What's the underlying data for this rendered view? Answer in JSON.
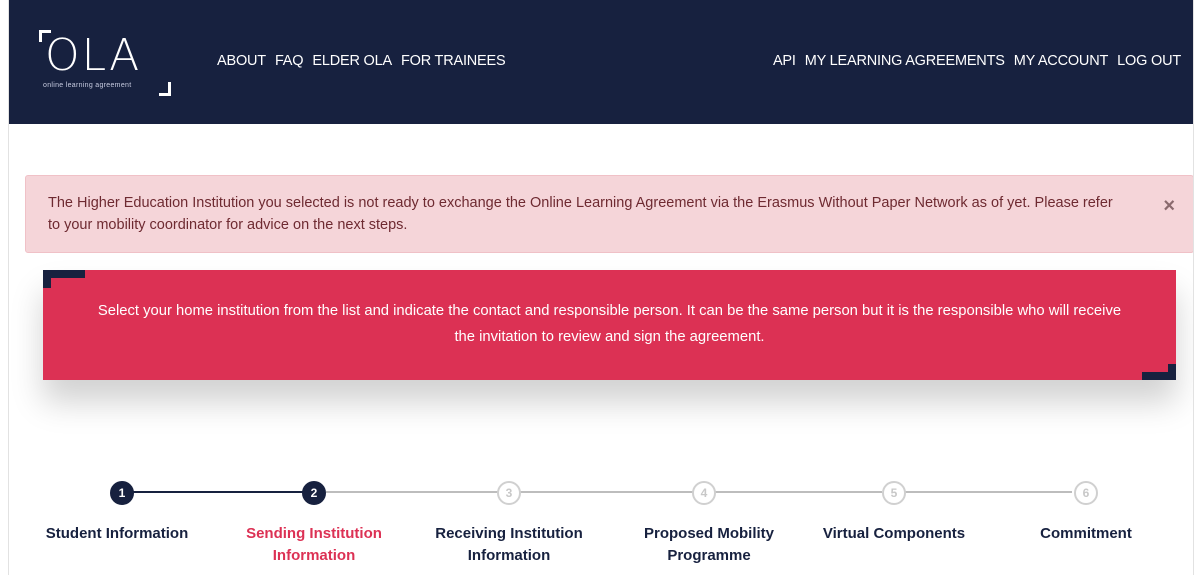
{
  "header": {
    "logo": {
      "text": "OLA",
      "subtitle": "online learning agreement"
    },
    "nav_left": [
      {
        "label": "ABOUT"
      },
      {
        "label": "FAQ"
      },
      {
        "label": "ELDER OLA"
      },
      {
        "label": "FOR TRAINEES"
      }
    ],
    "nav_right": [
      {
        "label": "API"
      },
      {
        "label": "MY LEARNING AGREEMENTS"
      },
      {
        "label": "MY ACCOUNT"
      },
      {
        "label": "LOG OUT"
      }
    ]
  },
  "alert": {
    "message": "The Higher Education Institution you selected is not ready to exchange the Online Learning Agreement via the Erasmus Without Paper Network as of yet. Please refer to your mobility coordinator for advice on the next steps.",
    "close_glyph": "×"
  },
  "banner": {
    "text": "Select your home institution from the list and indicate the contact and responsible person. It can be the same person but it is the responsible who will receive the invitation to review and sign the agreement."
  },
  "stepper": {
    "current_step": 2,
    "steps": [
      {
        "number": "1",
        "label": "Student Information",
        "state": "done"
      },
      {
        "number": "2",
        "label": "Sending Institution Information",
        "state": "active"
      },
      {
        "number": "3",
        "label": "Receiving Institution Information",
        "state": "pending"
      },
      {
        "number": "4",
        "label": "Proposed Mobility Programme",
        "state": "pending"
      },
      {
        "number": "5",
        "label": "Virtual Components",
        "state": "pending"
      },
      {
        "number": "6",
        "label": "Commitment",
        "state": "pending"
      }
    ]
  },
  "colors": {
    "navy": "#17213f",
    "accent_red": "#dc3154",
    "alert_bg": "#f5d5d9",
    "pending_grey": "#d0d0d0"
  }
}
